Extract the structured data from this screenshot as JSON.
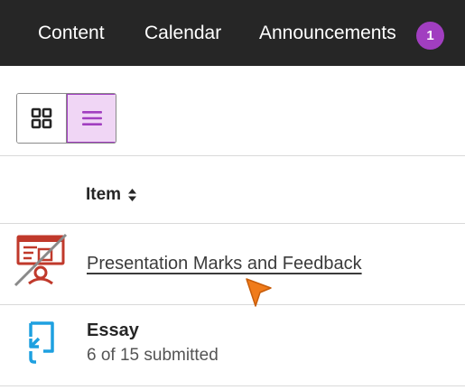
{
  "nav": {
    "items": [
      {
        "label": "Content"
      },
      {
        "label": "Calendar"
      },
      {
        "label": "Announcements"
      }
    ],
    "badge_count": "1",
    "badge_color": "#a13ec0"
  },
  "view_toggle": {
    "grid_icon": "grid-icon",
    "list_icon": "list-icon",
    "selected": "list",
    "selected_bg": "#f0d6f5",
    "selected_border": "#a13ec0"
  },
  "table": {
    "column_header": "Item",
    "sort_icon": "sort-icon",
    "rows": [
      {
        "title": "Presentation Marks and Feedback",
        "icon": "presentation-hidden-icon",
        "link": true
      },
      {
        "title": "Essay",
        "subtitle": "6 of 15 submitted",
        "icon": "assignment-icon"
      }
    ]
  },
  "colors": {
    "nav_bg": "#262626",
    "presentation_icon": "#c0392b",
    "assignment_icon": "#1ea0e0",
    "cursor": "#f07b1a"
  }
}
